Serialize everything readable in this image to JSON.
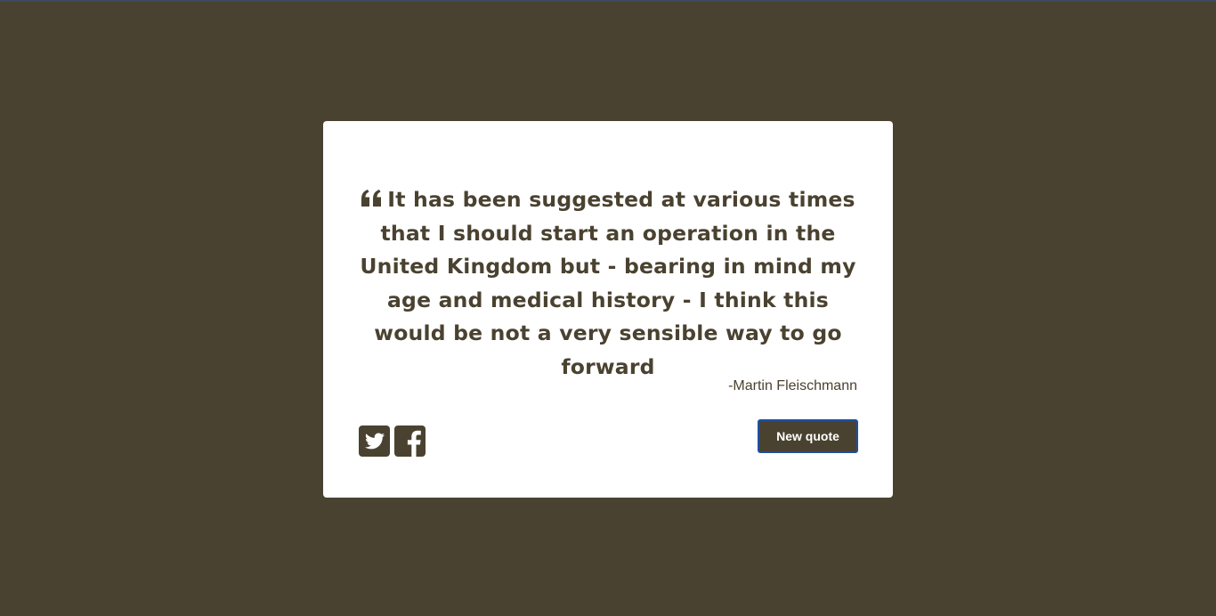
{
  "colors": {
    "background": "#4a4230",
    "card": "#ffffff",
    "text": "#4a4230",
    "button_border": "#1f4f9e"
  },
  "quote": {
    "icon": "quote-left-icon",
    "text": "It has been suggested at various times that I should start an operation in the United Kingdom but - bearing in mind my age and medical history - I think this would be not a very sensible way to go forward",
    "author": "-Martin Fleischmann"
  },
  "social": [
    {
      "icon": "twitter-icon"
    },
    {
      "icon": "facebook-icon"
    }
  ],
  "actions": {
    "new_quote_label": "New quote"
  }
}
